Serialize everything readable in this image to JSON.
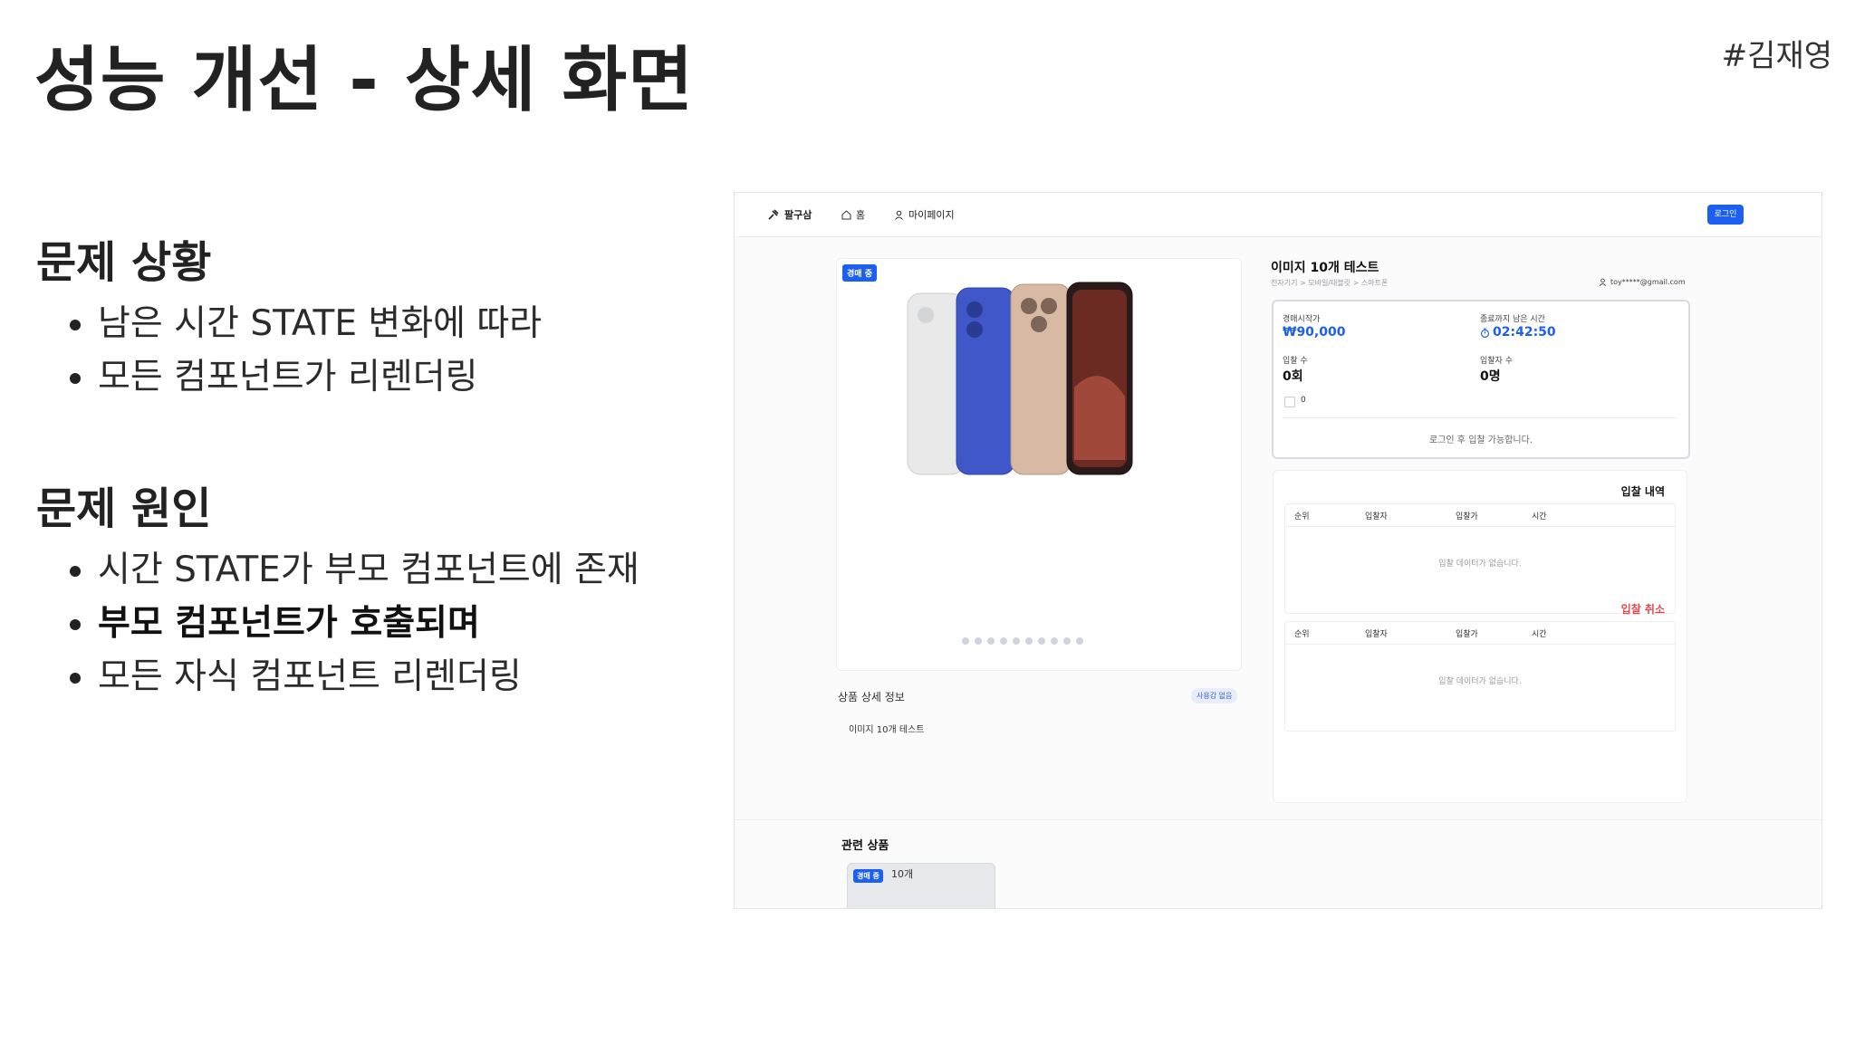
{
  "slide": {
    "title": "성능 개선 - 상세 화면",
    "author": "#김재영",
    "problem": {
      "heading": "문제 상황",
      "bullets": [
        "남은 시간 STATE 변화에 따라",
        "모든 컴포넌트가 리렌더링"
      ]
    },
    "cause": {
      "heading": "문제 원인",
      "bullets": [
        "시간 STATE가 부모 컴포넌트에 존재",
        "부모 컴포넌트가 호출되며",
        "모든 자식 컴포넌트 리렌더링"
      ]
    }
  },
  "screenshot": {
    "nav": {
      "brand": "팔구삼",
      "home": "홈",
      "mypage": "마이페이지",
      "login": "로그인"
    },
    "gallery": {
      "badge": "경매 중",
      "dots": 10
    },
    "detail": {
      "title": "상품 상세 정보",
      "tag": "사용감 없음",
      "text": "이미지 10개 테스트"
    },
    "product": {
      "title": "이미지 10개 테스트",
      "breadcrumb": "전자기기 > 모바일/태블릿 > 스마트폰",
      "seller": "toy*****@gmail.com"
    },
    "info": {
      "start_price_label": "경매시작가",
      "start_price": "₩90,000",
      "time_left_label": "종료까지 남은 시간",
      "time_left": "02:42:50",
      "bid_count_label": "입찰 수",
      "bid_count": "0회",
      "bidder_count_label": "입찰자 수",
      "bidder_count": "0명",
      "like_count": "0",
      "note": "로그인 후 입찰 가능합니다."
    },
    "bids": {
      "history_title": "입찰 내역",
      "cancel_title": "입찰 취소",
      "columns": [
        "순위",
        "입찰자",
        "입찰가",
        "시간"
      ],
      "empty": "입찰 데이터가 없습니다."
    },
    "related": {
      "title": "관련 상품",
      "badge": "경매 중",
      "card_name": "10개"
    },
    "colors": {
      "accent": "#1d5ff2",
      "cancel_red": "#e5484d"
    }
  }
}
